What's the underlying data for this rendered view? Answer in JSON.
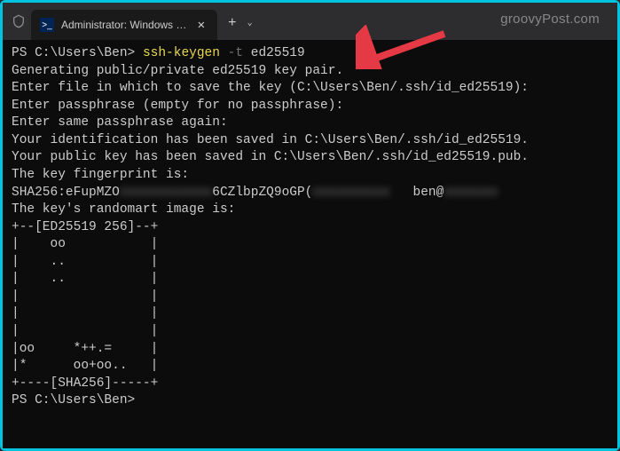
{
  "titlebar": {
    "tab_title": "Administrator: Windows Powe",
    "watermark": "groovyPost.com"
  },
  "terminal": {
    "prompt1": "PS C:\\Users\\Ben> ",
    "cmd_part1": "ssh-keygen",
    "cmd_flag": " -t",
    "cmd_part2": " ed25519",
    "line2": "Generating public/private ed25519 key pair.",
    "line3": "Enter file in which to save the key (C:\\Users\\Ben/.ssh/id_ed25519):",
    "line4": "Enter passphrase (empty for no passphrase):",
    "line5": "Enter same passphrase again:",
    "line6": "Your identification has been saved in C:\\Users\\Ben/.ssh/id_ed25519.",
    "line7": "Your public key has been saved in C:\\Users\\Ben/.ssh/id_ed25519.pub.",
    "line8": "The key fingerprint is:",
    "fp_prefix": "SHA256:eFupMZO",
    "fp_blur1": "xxxxxxxxxxxx",
    "fp_mid": "6CZlbpZQ9oGP(",
    "fp_blur2": "xxxxxxxxxx",
    "fp_user": "ben@",
    "fp_blur3": "xxxxxxx",
    "line10": "The key's randomart image is:",
    "art01": "+--[ED25519 256]--+",
    "art02": "|    oo           |",
    "art03": "|    ..           |",
    "art04": "|    ..           |",
    "art05": "|                 |",
    "art06": "|                 |",
    "art07": "|                 |",
    "art08": "|oo     *++.=     |",
    "art09": "|*      oo+oo..   |",
    "art10": "+----[SHA256]-----+",
    "prompt2": "PS C:\\Users\\Ben>"
  }
}
